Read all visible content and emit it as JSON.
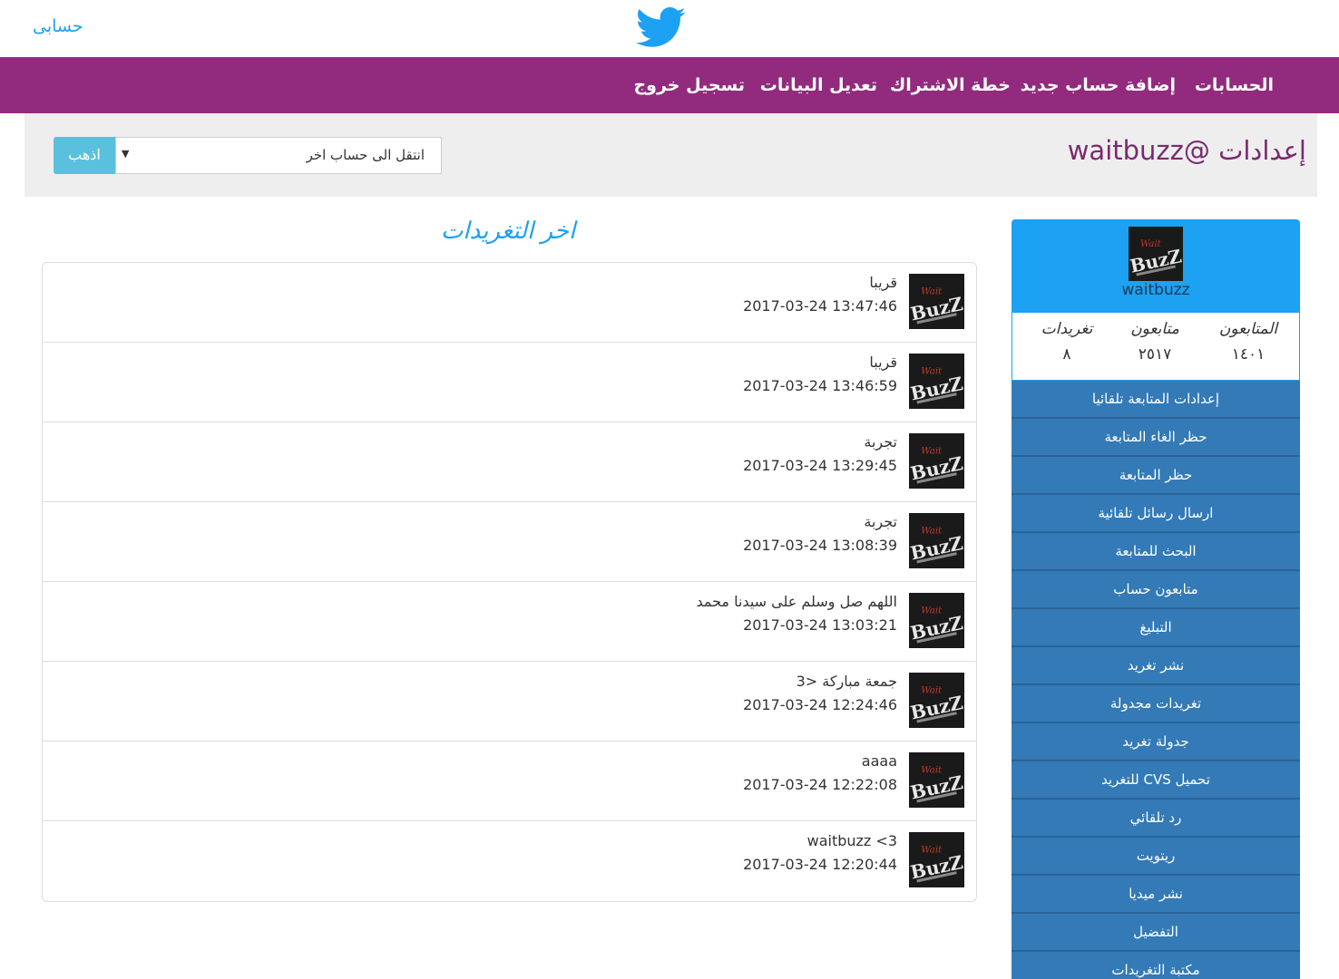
{
  "header": {
    "account_link": "حسابى",
    "logo_icon": "twitter-bird-icon"
  },
  "nav": {
    "items": [
      "الحسابات",
      "إضافة حساب جديد",
      "خطة الاشتراك",
      "تعديل البيانات",
      "تسجيل خروج"
    ]
  },
  "settings": {
    "title": "إعدادات @waitbuzz",
    "select_value": "انتقل الى حساب اخر",
    "go_label": "اذهب"
  },
  "tweets": {
    "heading": "اخر التغريدات",
    "items": [
      {
        "text": "قريبا",
        "date": "2017-03-24 13:47:46"
      },
      {
        "text": "قريبا",
        "date": "2017-03-24 13:46:59"
      },
      {
        "text": "تجربة",
        "date": "2017-03-24 13:29:45"
      },
      {
        "text": "تجربة",
        "date": "2017-03-24 13:08:39"
      },
      {
        "text": "اللهم صل وسلم على سيدنا محمد",
        "date": "2017-03-24 13:03:21"
      },
      {
        "text": "جمعة مباركة <3",
        "date": "2017-03-24 12:24:46"
      },
      {
        "text": "aaaa",
        "date": "2017-03-24 12:22:08"
      },
      {
        "text": "waitbuzz <3",
        "date": "2017-03-24 12:20:44"
      }
    ]
  },
  "profile": {
    "name": "waitbuzz",
    "stats": [
      {
        "label": "المتابعون",
        "value": "١٤٠١"
      },
      {
        "label": "متابعون",
        "value": "٢٥١٧"
      },
      {
        "label": "تغريدات",
        "value": "٨"
      }
    ]
  },
  "menu": {
    "items": [
      "إعدادات المتابعة تلقائيا",
      "حظر الغاء المتابعة",
      "حظر المتابعة",
      "ارسال رسائل تلقائية",
      "البحث للمتابعة",
      "متابعون حساب",
      "التبليغ",
      "نشر تغريد",
      "تغريدات مجدولة",
      "جدولة تغريد",
      "تحميل CVS للتغريد",
      "رد تلقائي",
      "ريتويت",
      "نشر ميديا",
      "التفضيل",
      "مكتبة التغريدات"
    ]
  },
  "colors": {
    "nav_bg": "#922b7e",
    "twitter_blue": "#1da1f2",
    "menu_bg": "#337ab7",
    "go_button": "#5bc0de"
  }
}
